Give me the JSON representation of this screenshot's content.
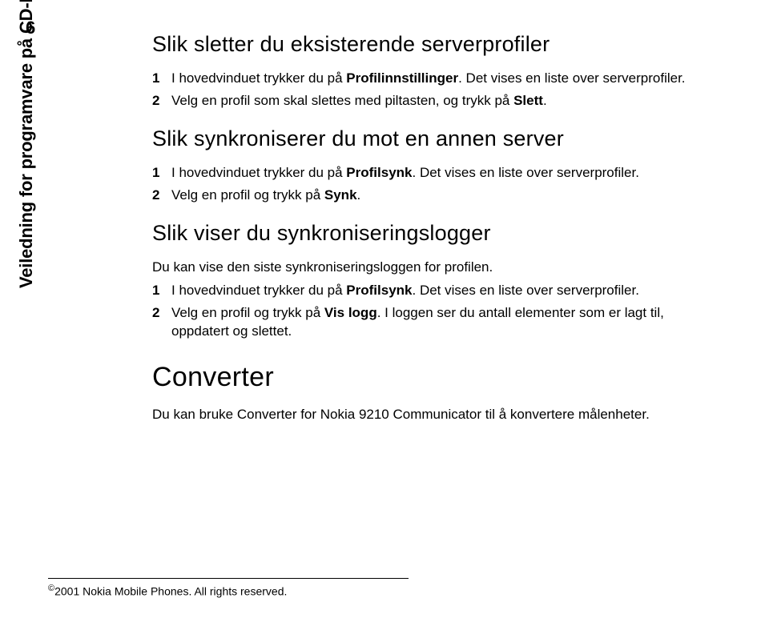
{
  "page_number": "6",
  "sidebar_label": "Veiledning for programvare på CD-ROM",
  "sections": {
    "delete_profiles": {
      "title": "Slik sletter du eksisterende serverprofiler",
      "steps": [
        {
          "num": "1",
          "text_before": "I hovedvinduet trykker du på ",
          "bold": "Profilinnstillinger",
          "text_after": ". Det vises en liste over serverprofiler."
        },
        {
          "num": "2",
          "text_before": "Velg en profil som skal slettes med piltasten, og trykk på ",
          "bold": "Slett",
          "text_after": "."
        }
      ]
    },
    "sync_other_server": {
      "title": "Slik synkroniserer du mot en annen server",
      "steps": [
        {
          "num": "1",
          "text_before": "I hovedvinduet trykker du på ",
          "bold": "Profilsynk",
          "text_after": ". Det vises en liste over serverprofiler."
        },
        {
          "num": "2",
          "text_before": "Velg en profil og trykk på ",
          "bold": "Synk",
          "text_after": "."
        }
      ]
    },
    "sync_logs": {
      "title": "Slik viser du synkroniseringslogger",
      "intro": "Du kan vise den siste synkroniseringsloggen for profilen.",
      "steps": [
        {
          "num": "1",
          "text_before": "I hovedvinduet trykker du på ",
          "bold": "Profilsynk",
          "text_after": ". Det vises en liste over serverprofiler."
        },
        {
          "num": "2",
          "text_before": "Velg en profil og trykk på ",
          "bold": "Vis logg",
          "text_after": ". I loggen ser du antall elementer som er lagt til, oppdatert og slettet."
        }
      ]
    },
    "converter": {
      "title": "Converter",
      "body": "Du kan bruke Converter for Nokia 9210 Communicator til å konvertere målenheter."
    }
  },
  "footer": {
    "copyright_symbol": "©",
    "text": "2001 Nokia Mobile Phones. All rights reserved."
  }
}
